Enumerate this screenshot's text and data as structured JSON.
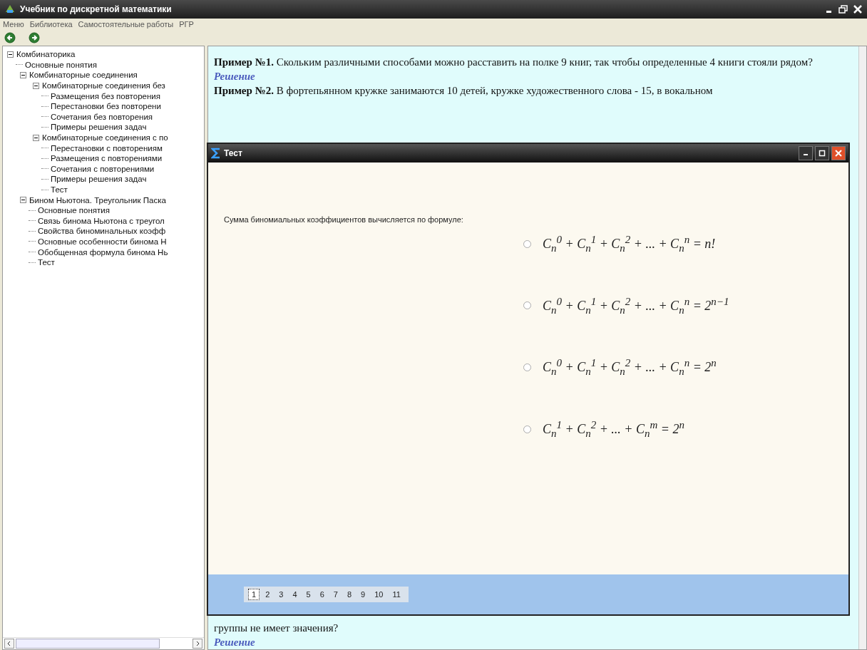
{
  "window": {
    "title": "Учебник по дискретной математики"
  },
  "menu": [
    "Меню",
    "Библиотека",
    "Самостоятельные работы",
    "РГР"
  ],
  "tree": [
    {
      "label": "Комбинаторика",
      "expanded": true,
      "children": [
        {
          "label": "Основные понятия"
        },
        {
          "label": "Комбинаторные соединения",
          "expanded": true,
          "children": [
            {
              "label": "Комбинаторные соединения без",
              "expanded": true,
              "children": [
                {
                  "label": "Размещения без повторения"
                },
                {
                  "label": "Перестановки без повторени"
                },
                {
                  "label": "Сочетания без повторения"
                },
                {
                  "label": "Примеры решения задач"
                }
              ]
            },
            {
              "label": "Комбинаторные соединения с по",
              "expanded": true,
              "children": [
                {
                  "label": "Перестановки с повторениям"
                },
                {
                  "label": "Размещения с повторениями"
                },
                {
                  "label": "Сочетания с повторениями"
                },
                {
                  "label": "Примеры решения задач"
                },
                {
                  "label": "Тест"
                }
              ]
            }
          ]
        },
        {
          "label": "Бином Ньютона. Треугольник Паска",
          "expanded": true,
          "children": [
            {
              "label": "Основные понятия"
            },
            {
              "label": "Связь бинома Ньютона с треугол"
            },
            {
              "label": "Свойства биноминальных коэфф"
            },
            {
              "label": "Основные особенности бинома Н"
            },
            {
              "label": "Обобщенная формула бинома Нь"
            },
            {
              "label": "Тест"
            }
          ]
        }
      ]
    }
  ],
  "content": {
    "top": [
      {
        "kind": "example",
        "text": "**Пример №1.** Скольким различными способами можно расставить на полке 9 книг, так чтобы определенные 4 книги стояли рядом?"
      },
      {
        "kind": "link",
        "text": "Решение"
      },
      {
        "kind": "example",
        "text": "**Пример №2.** В фортепьянном кружке занимаются 10 детей, кружке художественного слова - 15, в вокальном"
      }
    ],
    "bottom": [
      {
        "kind": "example",
        "text": "группы не имеет значения?"
      },
      {
        "kind": "link",
        "text": "Решение"
      }
    ]
  },
  "dialog": {
    "title": "Тест",
    "question": "Сумма биномиальных коэффициентов вычисляется по формуле:",
    "options": [
      {
        "formula": "C$_{n}$$^{0}$ + C$_{n}$$^{1}$ + C$_{n}$$^{2}$ + ... + C$_{n}$$^{n}$ = n!",
        "selected": false
      },
      {
        "formula": "C$_{n}$$^{0}$ + C$_{n}$$^{1}$ + C$_{n}$$^{2}$ + ... + C$_{n}$$^{n}$ = 2$^{n−1}$",
        "selected": false
      },
      {
        "formula": "C$_{n}$$^{0}$ + C$_{n}$$^{1}$ + C$_{n}$$^{2}$ + ... + C$_{n}$$^{n}$ = 2$^{n}$",
        "selected": false
      },
      {
        "formula": "C$_{n}$$^{1}$ + C$_{n}$$^{2}$ + ... + C$_{n}$$^{m}$ = 2$^{n}$",
        "selected": false
      }
    ],
    "pages": [
      {
        "label": "1",
        "selected": true
      },
      {
        "label": "2",
        "selected": false
      },
      {
        "label": "3",
        "selected": false
      },
      {
        "label": "4",
        "selected": false
      },
      {
        "label": "5",
        "selected": false
      },
      {
        "label": "6",
        "selected": false
      },
      {
        "label": "7",
        "selected": false
      },
      {
        "label": "8",
        "selected": false
      },
      {
        "label": "9",
        "selected": false
      },
      {
        "label": "10",
        "selected": false
      },
      {
        "label": "11",
        "selected": false
      }
    ]
  }
}
